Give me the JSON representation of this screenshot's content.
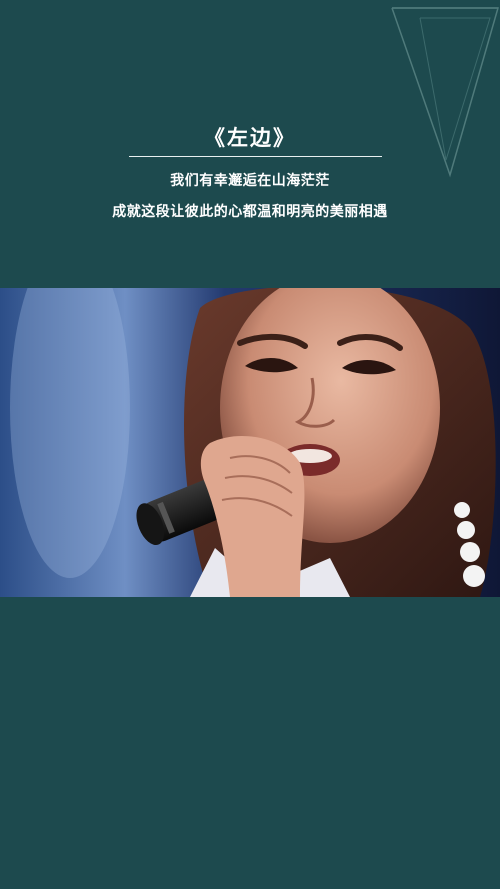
{
  "song": {
    "title": "《左边》",
    "lyric_lines": [
      "我们有幸邂逅在山海茫茫",
      "成就这段让彼此的心都温和明亮的美丽相遇"
    ]
  },
  "colors": {
    "background": "#1d4a4e",
    "text": "#ffffff"
  }
}
